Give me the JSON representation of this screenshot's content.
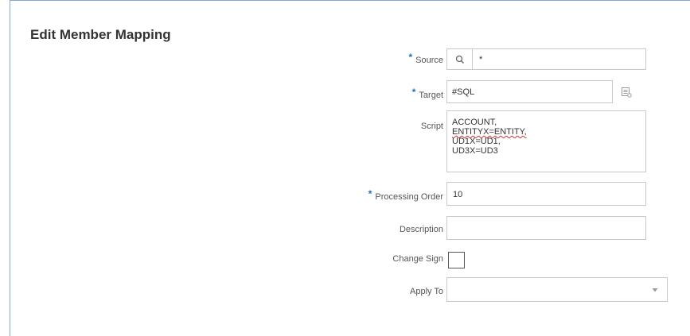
{
  "dialog": {
    "title": "Edit Member Mapping"
  },
  "form": {
    "source": {
      "label": "Source",
      "required": true,
      "value": "*"
    },
    "target": {
      "label": "Target",
      "required": true,
      "value": "#SQL"
    },
    "script": {
      "label": "Script",
      "required": false,
      "lines": [
        "ACCOUNT,",
        "ENTITYX=ENTITY,",
        "UD1X=UD1,",
        "UD3X=UD3"
      ],
      "misspelled_word": "ENTITYX"
    },
    "processing_order": {
      "label": "Processing Order",
      "required": true,
      "value": "10"
    },
    "description": {
      "label": "Description",
      "required": false,
      "value": ""
    },
    "change_sign": {
      "label": "Change Sign",
      "checked": false
    },
    "apply_to": {
      "label": "Apply To",
      "value": ""
    }
  },
  "icons": {
    "source_search": "search-icon",
    "target_picker": "list-picker-icon",
    "apply_to_dropdown": "dropdown-arrow-icon"
  },
  "colors": {
    "frame_border": "#7fa9d6",
    "required_marker": "#1d6fb8",
    "field_border": "#c9c9c9",
    "spellcheck_underline": "#d33333"
  }
}
